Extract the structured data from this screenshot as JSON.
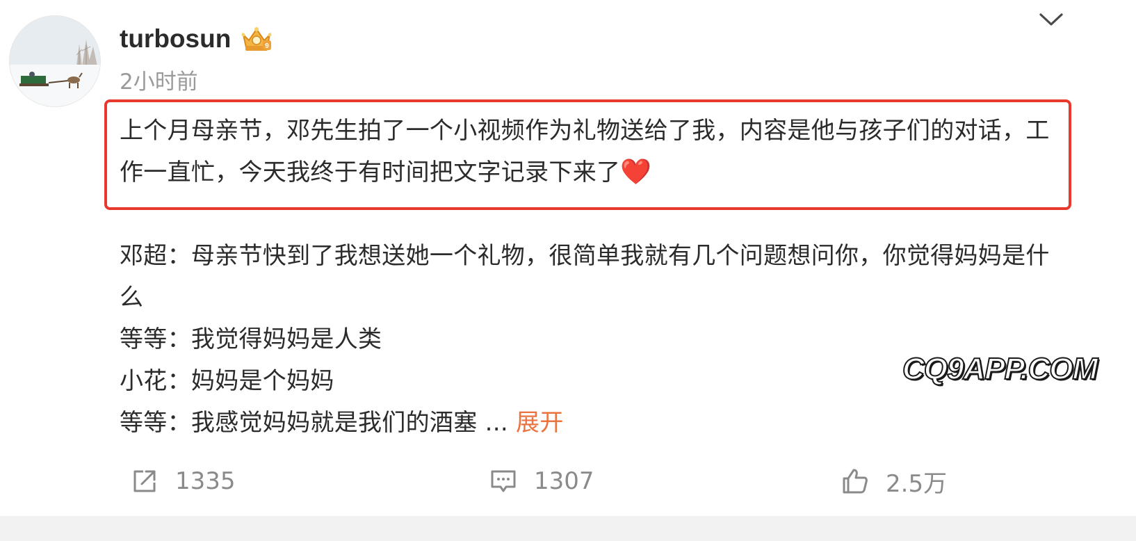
{
  "post": {
    "author": "turbosun",
    "time": "2小时前",
    "intro": "上个月母亲节，邓先生拍了一个小视频作为礼物送给了我，内容是他与孩子们的对话，工作一直忙，今天我终于有时间把文字记录下来了",
    "intro_emoji": "❤️",
    "dialogue": [
      "邓超：母亲节快到了我想送她一个礼物，很简单我就有几个问题想问你，你觉得妈妈是什么",
      "等等：我觉得妈妈是人类",
      "小花：妈妈是个妈妈",
      "等等：我感觉妈妈就是我们的酒塞  ..."
    ],
    "expand_label": "展开"
  },
  "watermark": "CQ9APP.COM",
  "actions": {
    "repost_count": "1335",
    "comment_count": "1307",
    "like_count": "2.5万"
  },
  "colors": {
    "highlight_border": "#e8392f",
    "expand_link": "#eb7340",
    "muted_text": "#9a9a9a"
  },
  "icons": {
    "header": [
      "avatar",
      "vip-crown-badge-icon",
      "chevron-down-icon"
    ],
    "actions": [
      "repost-icon",
      "comment-icon",
      "like-icon"
    ]
  }
}
